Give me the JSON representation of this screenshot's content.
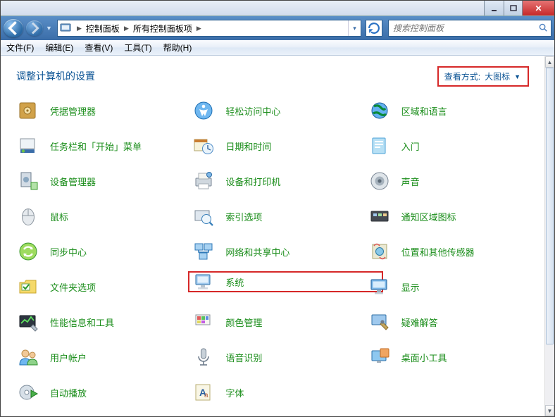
{
  "breadcrumb": {
    "seg1": "控制面板",
    "seg2": "所有控制面板项"
  },
  "search": {
    "placeholder": "搜索控制面板"
  },
  "menu": {
    "file": "文件(F)",
    "edit": "编辑(E)",
    "view": "查看(V)",
    "tools": "工具(T)",
    "help": "帮助(H)"
  },
  "heading": "调整计算机的设置",
  "viewby": {
    "label": "查看方式:",
    "value": "大图标"
  },
  "items": {
    "r0": {
      "c0": "凭据管理器",
      "c1": "轻松访问中心",
      "c2": "区域和语言"
    },
    "r1": {
      "c0": "任务栏和「开始」菜单",
      "c1": "日期和时间",
      "c2": "入门"
    },
    "r2": {
      "c0": "设备管理器",
      "c1": "设备和打印机",
      "c2": "声音"
    },
    "r3": {
      "c0": "鼠标",
      "c1": "索引选项",
      "c2": "通知区域图标"
    },
    "r4": {
      "c0": "同步中心",
      "c1": "网络和共享中心",
      "c2": "位置和其他传感器"
    },
    "r5": {
      "c0": "文件夹选项",
      "c1": "系统",
      "c2": "显示"
    },
    "r6": {
      "c0": "性能信息和工具",
      "c1": "颜色管理",
      "c2": "疑难解答"
    },
    "r7": {
      "c0": "用户帐户",
      "c1": "语音识别",
      "c2": "桌面小工具"
    },
    "r8": {
      "c0": "自动播放",
      "c1": "字体"
    }
  }
}
